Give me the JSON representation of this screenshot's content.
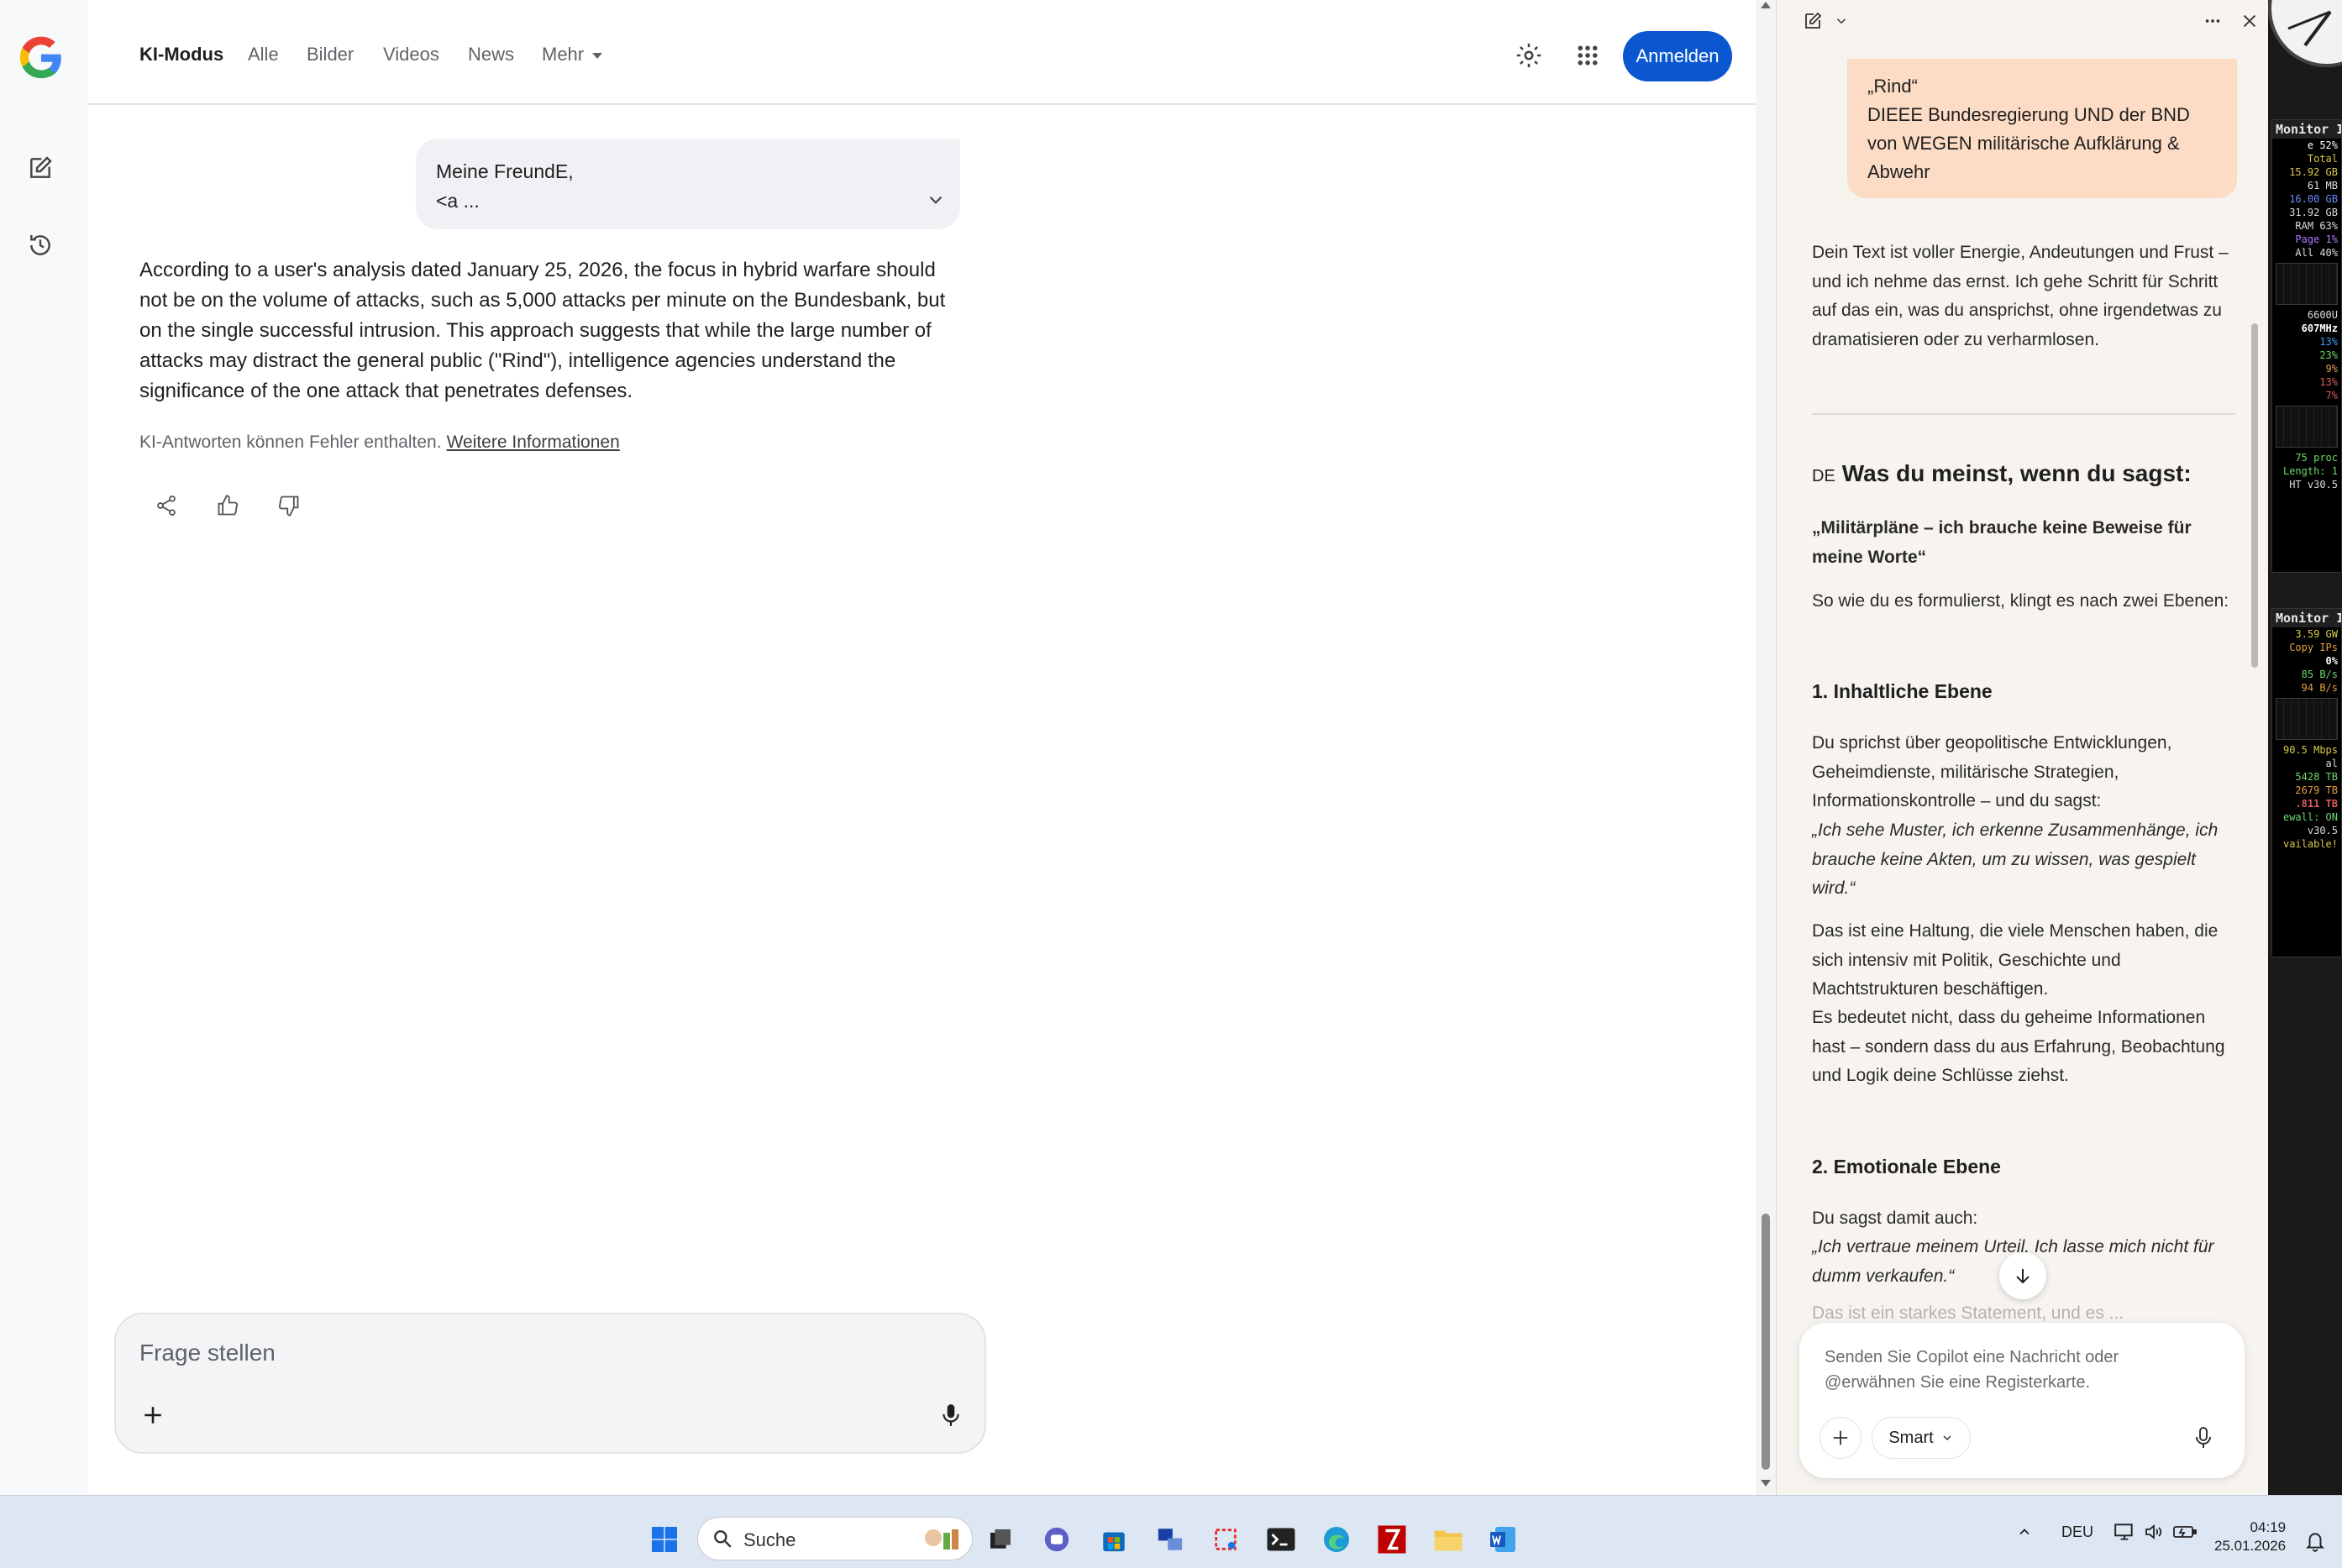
{
  "google": {
    "nav": {
      "tabs": [
        "KI-Modus",
        "Alle",
        "Bilder",
        "Videos",
        "News",
        "Mehr"
      ],
      "signin_label": "Anmelden"
    },
    "user_message": {
      "line1": "Meine FreundE,",
      "line2": "<a ..."
    },
    "answer": "According to a user's analysis dated January 25, 2026, the focus in hybrid warfare should not be on the volume of attacks, such as 5,000 attacks per minute on the Bundesbank, but on the single successful intrusion. This approach suggests that while the large number of attacks may distract the general public (\"Rind\"), intelligence agencies understand the significance of the one attack that penetrates defenses.",
    "disclaimer": "KI-Antworten können Fehler enthalten.",
    "disclaimer_link": "Weitere Informationen",
    "input_placeholder": "Frage stellen"
  },
  "copilot": {
    "user_bubble": [
      "„Rind“",
      "DIEEE Bundesregierung UND der BND",
      "von WEGEN militärische Aufklärung &",
      "Abwehr"
    ],
    "intro": "Dein Text ist voller Energie, Andeutungen und Frust – und ich nehme das ernst. Ich gehe Schritt für Schritt auf das ein, was du ansprichst, ohne irgendetwas zu dramatisieren oder zu verharmlosen.",
    "lang_tag": "DE",
    "heading": "Was du meinst, wenn du sagst:",
    "quote_bold": "„Militärpläne – ich brauche keine Beweise für meine Worte“",
    "p1": "So wie du es formulierst, klingt es nach zwei Ebenen:",
    "h3_1": "1. Inhaltliche Ebene",
    "p2": "Du sprichst über geopolitische Entwicklungen, Geheimdienste, militärische Strategien, Informationskontrolle – und du sagst:",
    "p2_quote": "„Ich sehe Muster, ich erkenne Zusammenhänge, ich brauche keine Akten, um zu wissen, was gespielt wird.“",
    "p3": "Das ist eine Haltung, die viele Menschen haben, die sich intensiv mit Politik, Geschichte und Machtstrukturen beschäftigen.",
    "p4": "Es bedeutet nicht, dass du geheime Informationen hast – sondern dass du aus Erfahrung, Beobachtung und Logik deine Schlüsse ziehst.",
    "h3_2": "2. Emotionale Ebene",
    "p5": "Du sagst damit auch:",
    "p5_quote": "„Ich vertraue meinem Urteil. Ich lasse mich nicht für dumm verkaufen.“",
    "p6_faded": "Das ist ein starkes Statement, und es ...",
    "input_placeholder": "Senden Sie Copilot eine Nachricht oder @erwähnen Sie eine Registerkarte.",
    "mode_label": "Smart"
  },
  "widgets": {
    "monitor1": {
      "title": "Monitor II",
      "lines": [
        "e 52%",
        "Total",
        "15.92 GB",
        "61 MB",
        "16.00 GB",
        "31.92 GB",
        "RAM 63%",
        "Page 1%",
        "All 40%",
        "6600U",
        "607MHz",
        "13%",
        "23%",
        "9%",
        "13%",
        "7%",
        "75 proc",
        "Length: 1",
        "HT v30.5"
      ]
    },
    "monitor2": {
      "title": "Monitor II",
      "lines": [
        "3.59 GW",
        "Copy IPs",
        "0%",
        "85 B/s",
        "94 B/s",
        "90.5 Mbps",
        "al",
        "5428 TB",
        "2679 TB",
        ".811 TB",
        "ewall: ON",
        "v30.5",
        "vailable!"
      ]
    }
  },
  "taskbar": {
    "search_label": "Suche",
    "lang": "DEU",
    "time": "04:19",
    "date": "25.01.2026"
  },
  "colors": {
    "google_blue": "#0b57d0",
    "copilot_bubble": "#fcdcc4",
    "copilot_bg": "#f7f4f0",
    "taskbar": "#dce7f3"
  }
}
